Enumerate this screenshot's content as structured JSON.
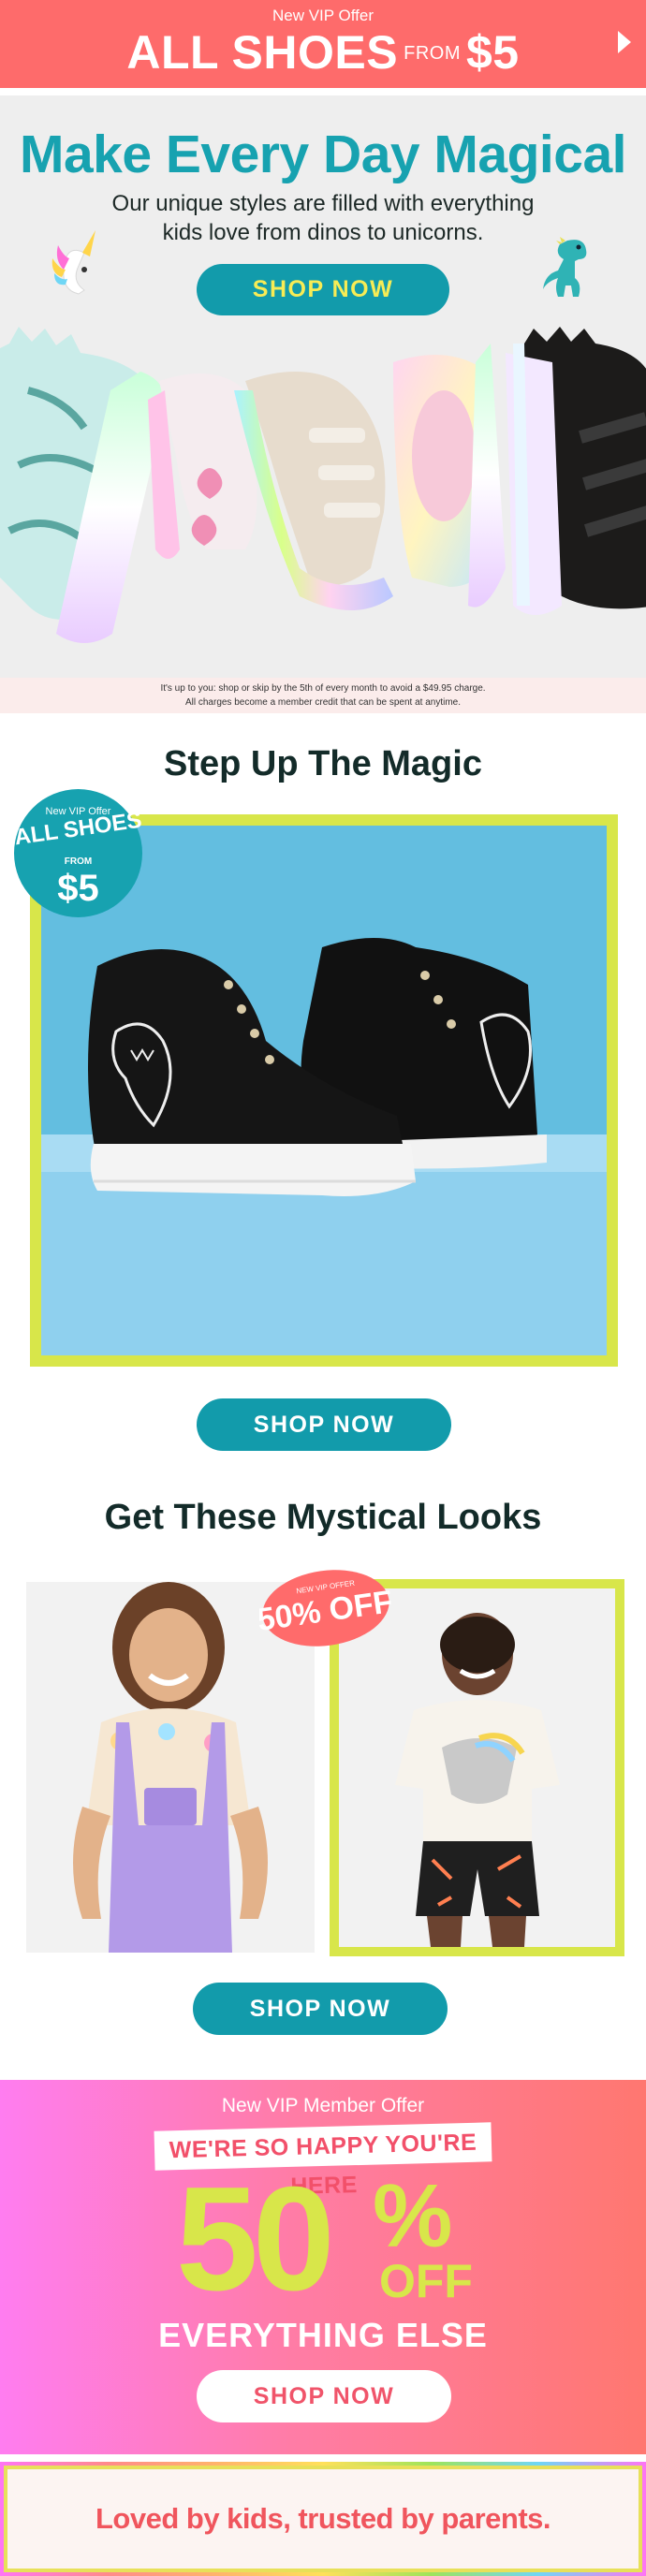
{
  "top_banner": {
    "eyebrow": "New VIP Offer",
    "headline_main": "ALL SHOES",
    "headline_from": "FROM",
    "headline_price": "$5"
  },
  "hero": {
    "title": "Make Every Day Magical",
    "subtitle_line1": "Our unique styles are filled with everything",
    "subtitle_line2": "kids love from dinos to unicorns.",
    "cta": "SHOP NOW",
    "legal_line1": "It's up to you: shop or skip by the 5th of every month to avoid a $49.95 charge.",
    "legal_line2": "All charges become a member credit that can be spent at anytime."
  },
  "step_up": {
    "title": "Step Up The Magic",
    "badge_eyebrow": "New VIP Offer",
    "badge_line1": "ALL SHOES",
    "badge_from": "FROM",
    "badge_price": "$5",
    "cta": "SHOP NOW"
  },
  "mystical": {
    "title": "Get These Mystical Looks",
    "badge_eyebrow": "NEW VIP OFFER",
    "badge_text": "50% OFF",
    "cta": "SHOP NOW"
  },
  "promo": {
    "eyebrow": "New VIP Member Offer",
    "tagline": "WE'RE SO HAPPY YOU'RE HERE",
    "big_number": "50",
    "percent": "%",
    "off": "OFF",
    "everything_else": "EVERYTHING ELSE",
    "cta": "SHOP NOW"
  },
  "footer": {
    "text": "Loved by kids, trusted by parents."
  },
  "colors": {
    "coral": "#fe6b6b",
    "teal": "#17a2b0",
    "lime": "#d8e64a",
    "dark_green": "#132b29",
    "sky": "#63bee0"
  }
}
